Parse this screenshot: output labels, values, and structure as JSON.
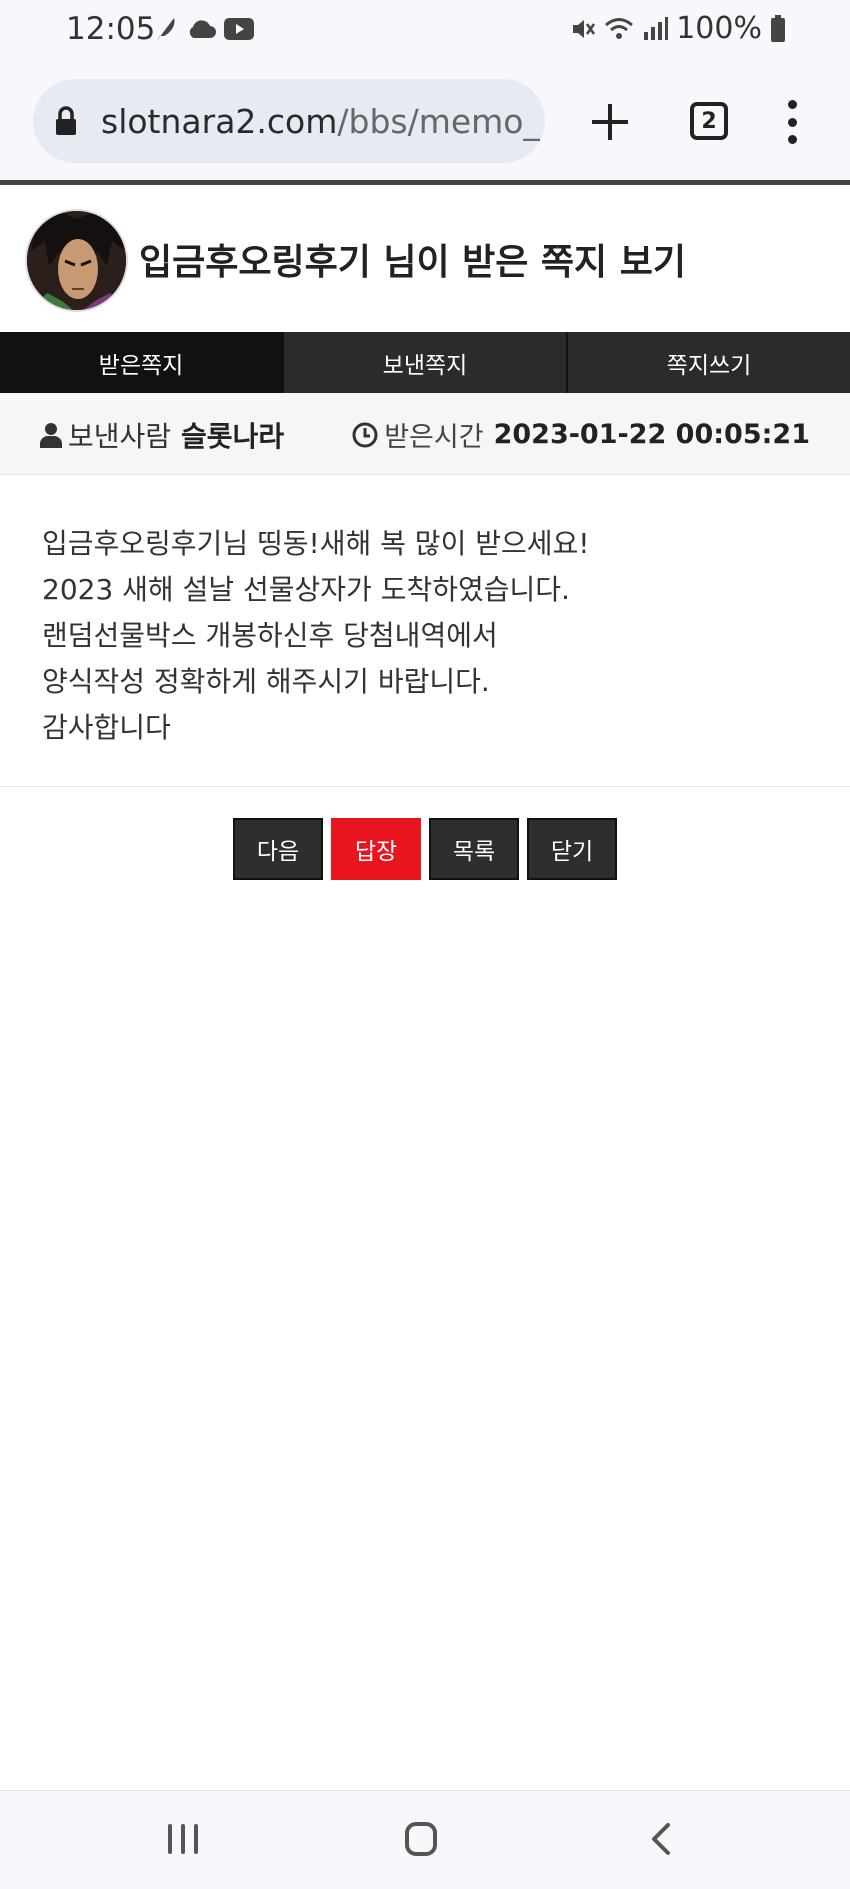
{
  "status_bar": {
    "time": "12:05",
    "battery": "100%",
    "left_icons": [
      "feather-icon",
      "cloud-icon",
      "youtube-icon"
    ],
    "right_icons": [
      "mute-icon",
      "wifi-icon",
      "signal-icon",
      "battery-icon"
    ]
  },
  "browser": {
    "url_host": "slotnara2.com",
    "url_path": "/bbs/memo_",
    "tab_count": "2"
  },
  "page": {
    "title": "입금후오링후기 님이 받은 쪽지 보기"
  },
  "tabs": [
    {
      "label": "받은쪽지",
      "active": true
    },
    {
      "label": "보낸쪽지",
      "active": false
    },
    {
      "label": "쪽지쓰기",
      "active": false
    }
  ],
  "info": {
    "sender_label": "보낸사람",
    "sender_name": "슬롯나라",
    "received_label": "받은시간",
    "received_time": "2023-01-22 00:05:21"
  },
  "message": {
    "lines": [
      "입금후오링후기님 띵동!새해 복 많이 받으세요!",
      "2023 새해 설날 선물상자가 도착하였습니다.",
      "랜덤선물박스 개봉하신후 당첨내역에서",
      "양식작성 정확하게 해주시기 바랍니다.",
      "감사합니다"
    ]
  },
  "buttons": {
    "next": "다음",
    "reply": "답장",
    "list": "목록",
    "close": "닫기"
  },
  "colors": {
    "reply_button": "#e8141e",
    "tab_active": "#111111",
    "tab_inactive": "#2b2b2b"
  }
}
